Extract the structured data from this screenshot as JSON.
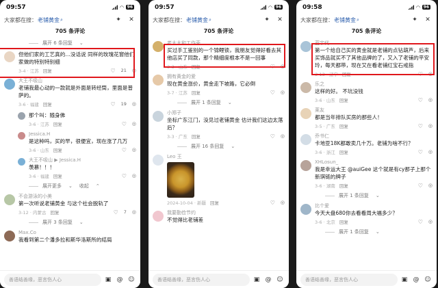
{
  "panels": [
    {
      "time": "09:57",
      "battery": "96",
      "search_prefix": "大家都在搜：",
      "search_term": "老铺黄金",
      "comment_count": "705 条评论",
      "expand_top": "展开 6 条回复",
      "comments": [
        {
          "user": "",
          "text": "但他们家的工艺真的…没话说 同样的玫瑰花窗他们家做的特别特别细",
          "meta": "3-4 · 江苏",
          "reply": "回复",
          "likes": "21",
          "is_reply": false
        },
        {
          "user": "大王不吸山",
          "text": "老铺我最心动的一款就是外面是转经筒，里面是普萨的。",
          "meta": "3-6 · 福建",
          "reply": "回复",
          "likes": "19",
          "is_reply": false
        },
        {
          "user": "",
          "text": "那个叫：随身佛",
          "meta": "3-6 · 江苏",
          "reply": "回复",
          "likes": "",
          "is_reply": true
        },
        {
          "user": "Jessica.H",
          "text": "是这种吗，买的早，很便宜，现在涨了几万",
          "meta": "3-6 · 山东",
          "reply": "回复",
          "likes": "",
          "is_reply": true
        },
        {
          "user": "大王不吸山 ▶ Jessica.H",
          "text": "羡慕！！！",
          "meta": "3-6 · 福建",
          "reply": "回复",
          "likes": "",
          "is_reply": true
        }
      ],
      "expand_more": "展开更多",
      "collapse": "收起",
      "comments2": [
        {
          "user": "不会游泳的小美",
          "text": "第一次听说老铺黄金 与这个社会脱轨了",
          "meta": "3-12 · 内蒙古",
          "reply": "回复",
          "likes": "7"
        }
      ],
      "expand_bottom": "展开 3 条回复",
      "last_user": "Max.Co",
      "last_text": "我看到第二个潘多拉和斯华洛斯所的结局"
    },
    {
      "time": "09:57",
      "battery": "96",
      "search_prefix": "大家都在搜：",
      "search_term": "老铺黄金",
      "comment_count": "705 条评论",
      "comments": [
        {
          "user": "老大大和工作壳",
          "text": "买过手工鉴别的一个锦鲤锁，我朋友觉得好看去其他店买了同款，那个精细度根本不是一回事",
          "meta": "3-3 · 山东",
          "reply": "回复",
          "likes": ""
        },
        {
          "user": "拥有黄金的爱",
          "text": "现在黄金涨价，黄金走下坡路，它必倒",
          "meta": "3-7 · 江苏",
          "reply": "回复",
          "likes": ""
        }
      ],
      "expand_a": "展开 1 条回复",
      "comments2": [
        {
          "user": "小郑子",
          "text": "坐标广东江门，没见过老铺黄金 估计我们这边太落后？",
          "meta": "3-3 · 广东",
          "reply": "回复",
          "likes": ""
        }
      ],
      "expand_b": "展开 16 条回复",
      "photo_user": "Leo 王",
      "photo_meta": "2024-10-04 · 新疆",
      "photo_reply": "回复",
      "comments3": [
        {
          "user": "我要勤俭节约",
          "text": "不觉得比老铺差",
          "meta": "",
          "reply": "",
          "likes": ""
        }
      ]
    },
    {
      "time": "09:58",
      "battery": "96",
      "search_prefix": "大家都在搜：",
      "search_term": "老铺黄金",
      "comment_count": "705 条评论",
      "comments": [
        {
          "user": "蓝宇代",
          "text": "第一个给自己买的黄金就是老铺的点钻葫芦，后来买饰品就买不了其他品牌的了，又入了老铺的平安玲，每天都带，现在又在看老铺红宝石戒指",
          "meta": "3-13 · 辽宁",
          "reply": "回复",
          "likes": ""
        },
        {
          "user": "乐之",
          "text": "这样的好。 不坑没钱",
          "meta": "3-6 · 山东",
          "reply": "回复",
          "likes": ""
        },
        {
          "user": "莱友",
          "text": "都是当年排队买房的那些人！",
          "meta": "3-5 · 广东",
          "reply": "回复",
          "likes": ""
        },
        {
          "user": "乔书仁",
          "text": "卡地亚18K都敢卖几十万。老铺为啥不行？",
          "meta": "3-6 · 浙江",
          "reply": "回复",
          "likes": ""
        },
        {
          "user": "XHLosun_",
          "text": "我是幸运大王 @auiGee 这个就是有cy那子上那个新琪链的牌子",
          "meta": "3-6 · 湖南",
          "reply": "回复",
          "likes": ""
        }
      ],
      "expand_a": "展开 1 条回复",
      "comments2": [
        {
          "user": "比个爱",
          "text": "今天大盘680你去看看周大福多少？",
          "meta": "3-6 · 北京",
          "reply": "回复",
          "likes": ""
        }
      ],
      "expand_b": "展开 1 条回复"
    }
  ],
  "input_placeholder": "善语结善缘，恶言伤人心",
  "icons": {
    "image": "image-icon",
    "at": "at-icon",
    "emoji": "emoji-icon",
    "close": "close-icon",
    "star": "sparkle-icon"
  }
}
